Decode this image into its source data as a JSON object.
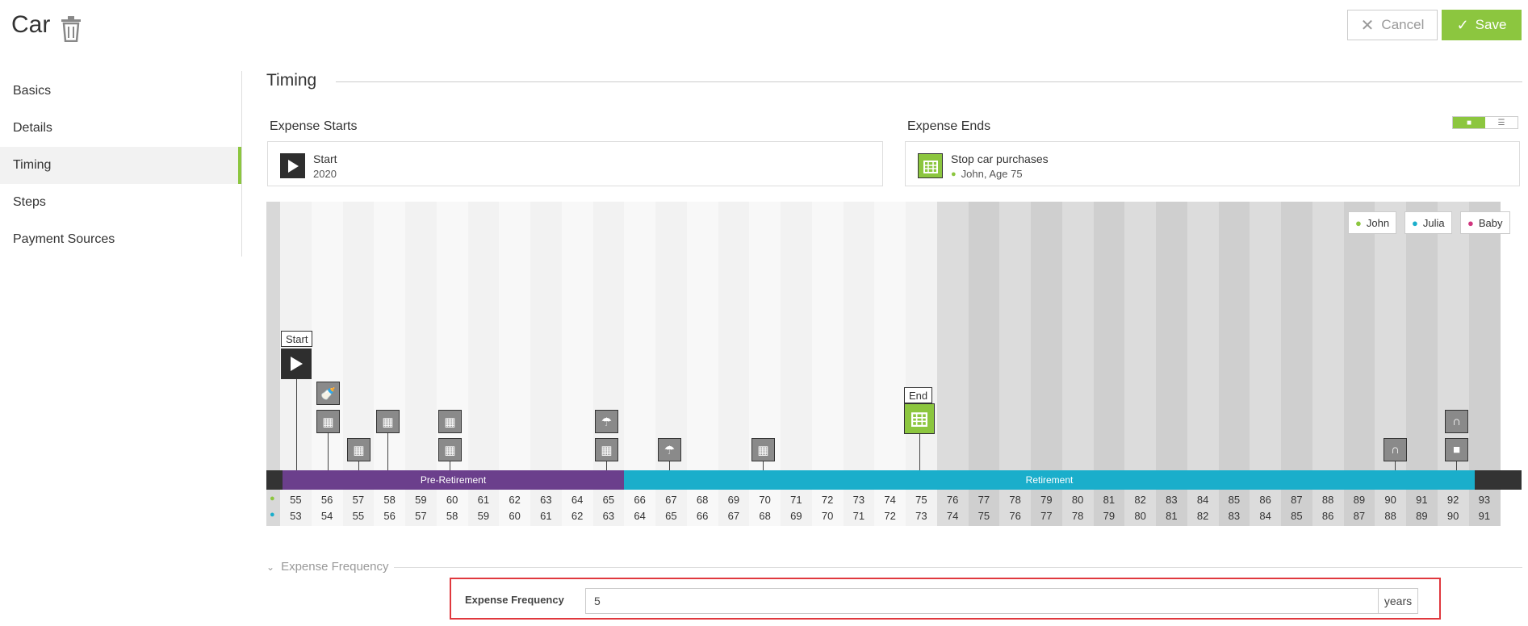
{
  "header": {
    "title": "Car",
    "cancel_label": "Cancel",
    "save_label": "Save"
  },
  "sidebar": {
    "items": [
      {
        "label": "Basics",
        "active": false
      },
      {
        "label": "Details",
        "active": false
      },
      {
        "label": "Timing",
        "active": true
      },
      {
        "label": "Steps",
        "active": false
      },
      {
        "label": "Payment Sources",
        "active": false
      }
    ]
  },
  "timing": {
    "section_title": "Timing",
    "starts": {
      "heading": "Expense Starts",
      "title": "Start",
      "sub": "2020"
    },
    "ends": {
      "heading": "Expense Ends",
      "title": "Stop car purchases",
      "sub": "John, Age 75"
    },
    "people": [
      "John",
      "Julia",
      "Baby"
    ],
    "start_flag": "Start",
    "end_flag": "End",
    "phases": {
      "pre": "Pre-Retirement",
      "post": "Retirement"
    },
    "john_ages": [
      "55",
      "56",
      "57",
      "58",
      "59",
      "60",
      "61",
      "62",
      "63",
      "64",
      "65",
      "66",
      "67",
      "68",
      "69",
      "70",
      "71",
      "72",
      "73",
      "74",
      "75",
      "76",
      "77",
      "78",
      "79",
      "80",
      "81",
      "82",
      "83",
      "84",
      "85",
      "86",
      "87",
      "88",
      "89",
      "90",
      "91",
      "92",
      "93"
    ],
    "julia_ages": [
      "53",
      "54",
      "55",
      "56",
      "57",
      "58",
      "59",
      "60",
      "61",
      "62",
      "63",
      "64",
      "65",
      "66",
      "67",
      "68",
      "69",
      "70",
      "71",
      "72",
      "73",
      "74",
      "75",
      "76",
      "77",
      "78",
      "79",
      "80",
      "81",
      "82",
      "83",
      "84",
      "85",
      "86",
      "87",
      "88",
      "89",
      "90",
      "91"
    ]
  },
  "frequency": {
    "section_label": "Expense Frequency",
    "field_label": "Expense Frequency",
    "value": "5",
    "unit": "years"
  },
  "colors": {
    "accent": "#8cc63f",
    "pre_retirement": "#6b3f8c",
    "retirement": "#1aaecb",
    "john": "#8cc63f",
    "julia": "#1aaecb",
    "baby": "#d0357e"
  }
}
